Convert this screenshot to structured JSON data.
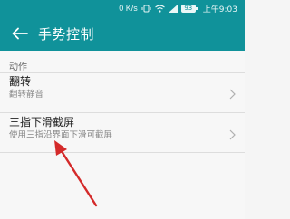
{
  "status_bar": {
    "network_speed": "0 K/s",
    "battery_level": "93",
    "time": "上午9:03"
  },
  "app_bar": {
    "title": "手势控制"
  },
  "section": {
    "header": "动作"
  },
  "items": [
    {
      "title": "翻转",
      "subtitle": "翻转静音"
    },
    {
      "title": "三指下滑截屏",
      "subtitle": "使用三指沿界面下滑可截屏"
    }
  ],
  "colors": {
    "app_bar": "#10929a",
    "annotation_arrow": "#d42a2a"
  },
  "icons": {
    "back": "arrow-left-icon",
    "chevron": "chevron-right-icon"
  }
}
